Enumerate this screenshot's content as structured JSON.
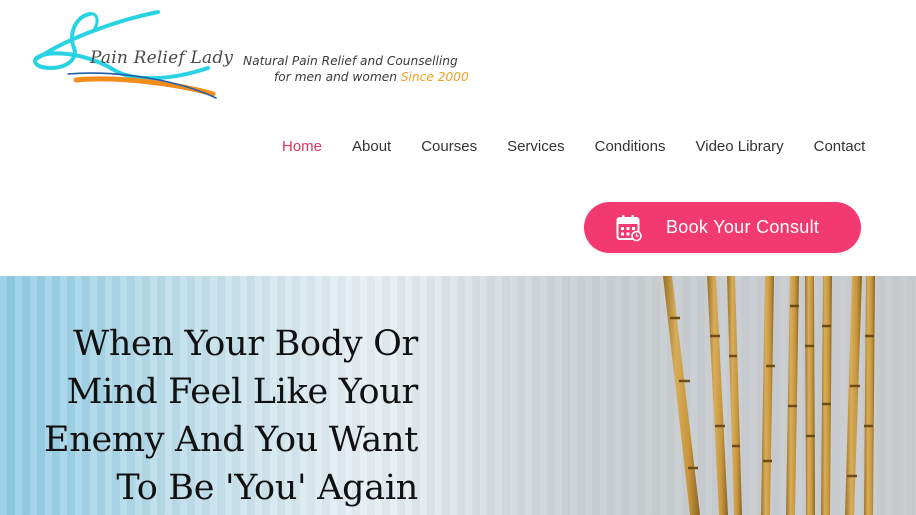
{
  "brand": {
    "name": "Pain Relief Lady",
    "tagline_line1": "Natural Pain Relief and Counselling",
    "tagline_line2": "for men and women",
    "tagline_since": "Since 2000",
    "colors": {
      "logo_cyan": "#29d3e3",
      "logo_orange": "#f28c1b",
      "logo_blue": "#1f5fa8"
    }
  },
  "nav": {
    "items": [
      {
        "label": "Home",
        "active": true
      },
      {
        "label": "About"
      },
      {
        "label": "Courses"
      },
      {
        "label": "Services"
      },
      {
        "label": "Conditions"
      },
      {
        "label": "Video Library"
      },
      {
        "label": "Contact"
      }
    ],
    "active_color": "#e1365f"
  },
  "cta": {
    "label": "Book Your Consult",
    "icon": "calendar-icon",
    "color": "#f23a71"
  },
  "hero": {
    "heading": "When Your Body Or Mind Feel Like Your Enemy And You Want To Be 'You' Again"
  }
}
